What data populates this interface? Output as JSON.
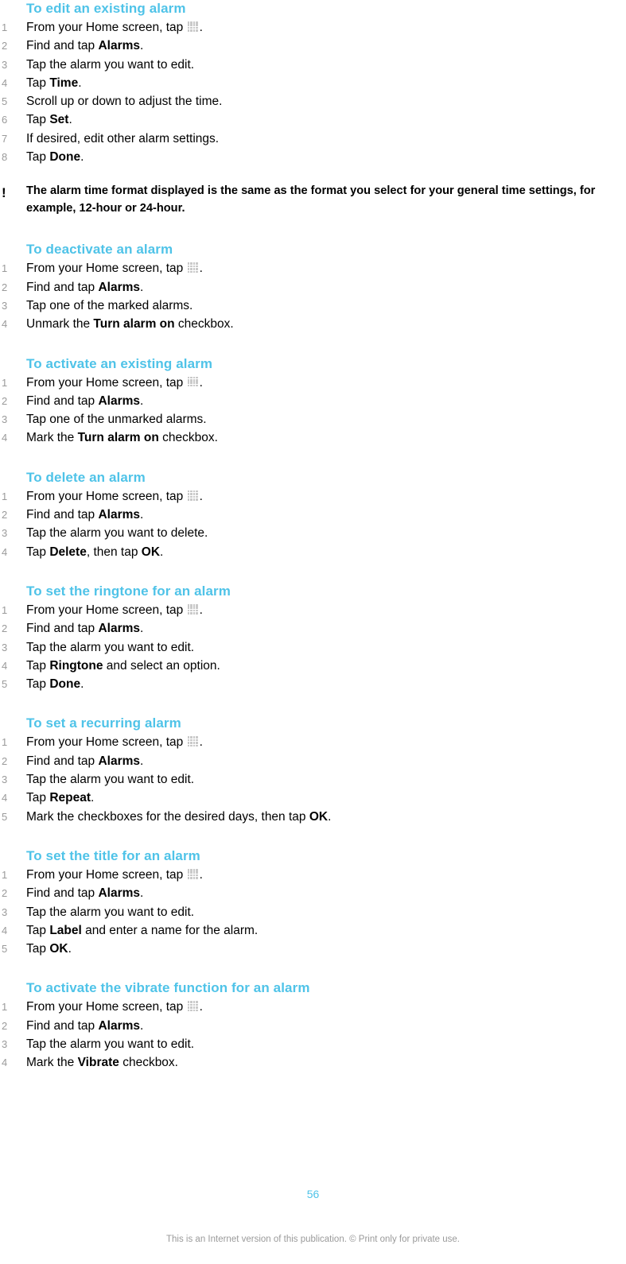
{
  "document": {
    "page_number": "56",
    "footer_note": "This is an Internet version of this publication. © Print only for private use.",
    "accent_color": "#4FC3E8",
    "number_color": "#9a9a9a",
    "icon_color": "#c9c9c9"
  },
  "icons": {
    "app_grid": "app-grid-icon",
    "note_bang": "exclamation-icon"
  },
  "sections": [
    {
      "heading": "To edit an existing alarm",
      "steps": [
        {
          "num": "1",
          "prefix": "From your Home screen, tap ",
          "icon": true,
          "suffix": "."
        },
        {
          "num": "2",
          "prefix": "Find and tap ",
          "bold": "Alarms",
          "suffix": "."
        },
        {
          "num": "3",
          "prefix": "Tap the alarm you want to edit.",
          "suffix": ""
        },
        {
          "num": "4",
          "prefix": "Tap ",
          "bold": "Time",
          "suffix": "."
        },
        {
          "num": "5",
          "prefix": "Scroll up or down to adjust the time.",
          "suffix": ""
        },
        {
          "num": "6",
          "prefix": "Tap ",
          "bold": "Set",
          "suffix": "."
        },
        {
          "num": "7",
          "prefix": "If desired, edit other alarm settings.",
          "suffix": ""
        },
        {
          "num": "8",
          "prefix": "Tap ",
          "bold": "Done",
          "suffix": "."
        }
      ]
    },
    {
      "heading": "To deactivate an alarm",
      "steps": [
        {
          "num": "1",
          "prefix": "From your Home screen, tap ",
          "icon": true,
          "suffix": "."
        },
        {
          "num": "2",
          "prefix": "Find and tap ",
          "bold": "Alarms",
          "suffix": "."
        },
        {
          "num": "3",
          "prefix": "Tap one of the marked alarms.",
          "suffix": ""
        },
        {
          "num": "4",
          "prefix": "Unmark the ",
          "bold": "Turn alarm on",
          "suffix": " checkbox."
        }
      ]
    },
    {
      "heading": "To activate an existing alarm",
      "steps": [
        {
          "num": "1",
          "prefix": "From your Home screen, tap ",
          "icon": true,
          "suffix": "."
        },
        {
          "num": "2",
          "prefix": "Find and tap ",
          "bold": "Alarms",
          "suffix": "."
        },
        {
          "num": "3",
          "prefix": "Tap one of the unmarked alarms.",
          "suffix": ""
        },
        {
          "num": "4",
          "prefix": "Mark the ",
          "bold": "Turn alarm on",
          "suffix": " checkbox."
        }
      ]
    },
    {
      "heading": "To delete an alarm",
      "steps": [
        {
          "num": "1",
          "prefix": "From your Home screen, tap ",
          "icon": true,
          "suffix": "."
        },
        {
          "num": "2",
          "prefix": "Find and tap ",
          "bold": "Alarms",
          "suffix": "."
        },
        {
          "num": "3",
          "prefix": "Tap the alarm you want to delete.",
          "suffix": ""
        },
        {
          "num": "4",
          "prefix": "Tap ",
          "bold": "Delete",
          "suffix": ", then tap ",
          "bold2": "OK",
          "suffix2": "."
        }
      ]
    },
    {
      "heading": "To set the ringtone for an alarm",
      "steps": [
        {
          "num": "1",
          "prefix": "From your Home screen, tap ",
          "icon": true,
          "suffix": "."
        },
        {
          "num": "2",
          "prefix": "Find and tap ",
          "bold": "Alarms",
          "suffix": "."
        },
        {
          "num": "3",
          "prefix": "Tap the alarm you want to edit.",
          "suffix": ""
        },
        {
          "num": "4",
          "prefix": "Tap ",
          "bold": "Ringtone",
          "suffix": " and select an option."
        },
        {
          "num": "5",
          "prefix": "Tap ",
          "bold": "Done",
          "suffix": "."
        }
      ]
    },
    {
      "heading": "To set a recurring alarm",
      "steps": [
        {
          "num": "1",
          "prefix": "From your Home screen, tap ",
          "icon": true,
          "suffix": "."
        },
        {
          "num": "2",
          "prefix": "Find and tap ",
          "bold": "Alarms",
          "suffix": "."
        },
        {
          "num": "3",
          "prefix": "Tap the alarm you want to edit.",
          "suffix": ""
        },
        {
          "num": "4",
          "prefix": "Tap ",
          "bold": "Repeat",
          "suffix": "."
        },
        {
          "num": "5",
          "prefix": "Mark the checkboxes for the desired days, then tap ",
          "bold": "OK",
          "suffix": "."
        }
      ]
    },
    {
      "heading": "To set the title for an alarm",
      "steps": [
        {
          "num": "1",
          "prefix": "From your Home screen, tap ",
          "icon": true,
          "suffix": "."
        },
        {
          "num": "2",
          "prefix": "Find and tap ",
          "bold": "Alarms",
          "suffix": "."
        },
        {
          "num": "3",
          "prefix": "Tap the alarm you want to edit.",
          "suffix": ""
        },
        {
          "num": "4",
          "prefix": "Tap ",
          "bold": "Label",
          "suffix": " and enter a name for the alarm."
        },
        {
          "num": "5",
          "prefix": "Tap ",
          "bold": "OK",
          "suffix": "."
        }
      ]
    },
    {
      "heading": "To activate the vibrate function for an alarm",
      "steps": [
        {
          "num": "1",
          "prefix": "From your Home screen, tap ",
          "icon": true,
          "suffix": "."
        },
        {
          "num": "2",
          "prefix": "Find and tap ",
          "bold": "Alarms",
          "suffix": "."
        },
        {
          "num": "3",
          "prefix": "Tap the alarm you want to edit.",
          "suffix": ""
        },
        {
          "num": "4",
          "prefix": "Mark the ",
          "bold": "Vibrate",
          "suffix": " checkbox."
        }
      ]
    }
  ],
  "note": {
    "marker": "!",
    "text": "The alarm time format displayed is the same as the format you select for your general time settings, for example, 12-hour or 24-hour."
  }
}
